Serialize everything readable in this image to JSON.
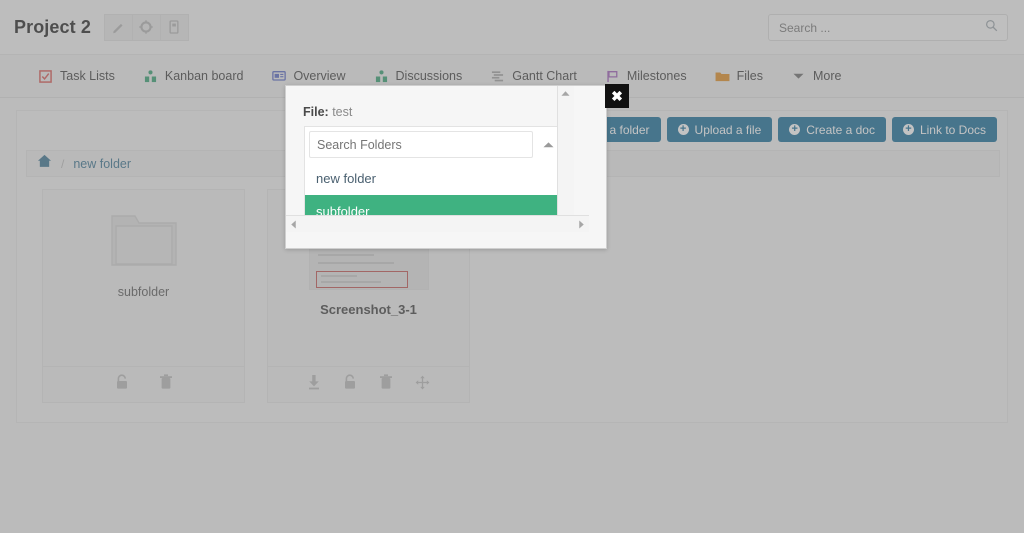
{
  "header": {
    "project_title": "Project 2",
    "tools": [
      {
        "name": "edit-project-button",
        "icon": "pencil-icon"
      },
      {
        "name": "project-settings-button",
        "icon": "gear-icon"
      },
      {
        "name": "project-notebook-button",
        "icon": "notebook-icon"
      }
    ],
    "search": {
      "placeholder": "Search ...",
      "value": "",
      "icon": "search-icon"
    }
  },
  "nav": {
    "tabs": [
      {
        "label": "Task Lists",
        "icon": "checkbox-icon",
        "color": "#d9534f"
      },
      {
        "label": "Kanban board",
        "icon": "kanban-icon",
        "color": "#2f9e6e"
      },
      {
        "label": "Overview",
        "icon": "overview-icon",
        "color": "#5566c4"
      },
      {
        "label": "Discussions",
        "icon": "discussions-icon",
        "color": "#2f9e6e"
      },
      {
        "label": "Gantt Chart",
        "icon": "gantt-icon",
        "color": "#9a9a9a"
      },
      {
        "label": "Milestones",
        "icon": "flag-icon",
        "color": "#9b59b6"
      },
      {
        "label": "Files",
        "icon": "folder-icon",
        "color": "#e08a1e"
      },
      {
        "label": "More",
        "icon": "chevron-down-icon",
        "color": "#6a6a6a"
      }
    ]
  },
  "content": {
    "actions": [
      {
        "label": "Create a folder",
        "icon": "plus-circle-icon"
      },
      {
        "label": "Upload a file",
        "icon": "plus-circle-icon"
      },
      {
        "label": "Create a doc",
        "icon": "plus-circle-icon"
      },
      {
        "label": "Link to Docs",
        "icon": "plus-circle-icon"
      }
    ],
    "action_color": "#126a96",
    "breadcrumb": {
      "home_icon": "home-icon",
      "separator": "/",
      "current": "new folder"
    },
    "items": [
      {
        "type": "folder",
        "name": "subfolder",
        "icon": "folder-large-icon",
        "actions": [
          {
            "name": "lock-icon"
          },
          {
            "name": "trash-icon"
          }
        ]
      },
      {
        "type": "file",
        "name": "Screenshot_3-1",
        "icon": "image-thumbnail",
        "actions": [
          {
            "name": "download-icon"
          },
          {
            "name": "lock-icon"
          },
          {
            "name": "trash-icon"
          },
          {
            "name": "move-icon"
          }
        ]
      }
    ]
  },
  "modal": {
    "label_prefix": "File:",
    "label_value": "test",
    "select": {
      "placeholder": "Search Folders",
      "value": "",
      "caret_icon": "chevron-up-icon",
      "options": [
        {
          "label": "new folder",
          "selected": false
        },
        {
          "label": "subfolder",
          "selected": true
        }
      ],
      "selected_color": "#3fb281"
    },
    "close_label": "✖",
    "scrollbars": {
      "vertical": {
        "up": "▲",
        "down": "▼"
      },
      "horizontal": {
        "left": "◀",
        "right": "▶"
      }
    }
  }
}
